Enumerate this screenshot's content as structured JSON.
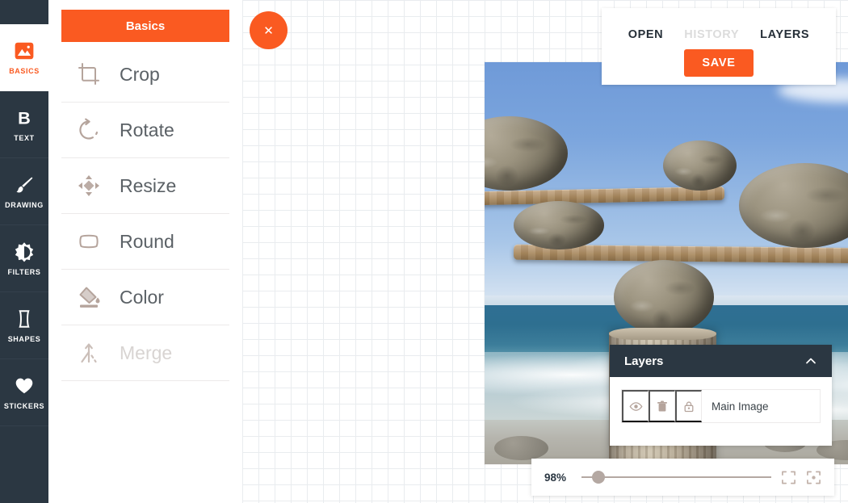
{
  "app": {
    "accent_color": "#fa5a21",
    "dark_color": "#2b3742",
    "icon_color": "#b5a49c"
  },
  "rail": {
    "items": [
      {
        "label": "BASICS",
        "icon": "image-icon",
        "active": true
      },
      {
        "label": "TEXT",
        "icon": "text-b-icon",
        "active": false
      },
      {
        "label": "DRAWING",
        "icon": "brush-icon",
        "active": false
      },
      {
        "label": "FILTERS",
        "icon": "contrast-icon",
        "active": false
      },
      {
        "label": "SHAPES",
        "icon": "shape-icon",
        "active": false
      },
      {
        "label": "STICKERS",
        "icon": "heart-icon",
        "active": false
      }
    ]
  },
  "menu": {
    "title": "Basics",
    "items": [
      {
        "label": "Crop",
        "icon": "crop-icon",
        "disabled": false
      },
      {
        "label": "Rotate",
        "icon": "rotate-icon",
        "disabled": false
      },
      {
        "label": "Resize",
        "icon": "resize-icon",
        "disabled": false
      },
      {
        "label": "Round",
        "icon": "round-icon",
        "disabled": false
      },
      {
        "label": "Color",
        "icon": "color-icon",
        "disabled": false
      },
      {
        "label": "Merge",
        "icon": "merge-icon",
        "disabled": true
      }
    ]
  },
  "close_button": {
    "glyph": "✕",
    "icon": "close-icon"
  },
  "topbar": {
    "links": [
      {
        "label": "OPEN",
        "disabled": false
      },
      {
        "label": "HISTORY",
        "disabled": true
      },
      {
        "label": "LAYERS",
        "disabled": false
      }
    ],
    "save_label": "SAVE"
  },
  "layers": {
    "title": "Layers",
    "collapse_icon": "chevron-up-icon",
    "rows": [
      {
        "name": "Main Image",
        "visibility_icon": "eye-icon",
        "delete_icon": "trash-icon",
        "lock_icon": "lock-icon"
      }
    ]
  },
  "zoombar": {
    "value": "98%",
    "slider_percent": 9,
    "fit_icon": "fit-to-screen-icon",
    "center_icon": "center-image-icon"
  },
  "canvas": {
    "photo_alt": "Balanced stones on wooden planks atop a weathered post at the seashore"
  }
}
